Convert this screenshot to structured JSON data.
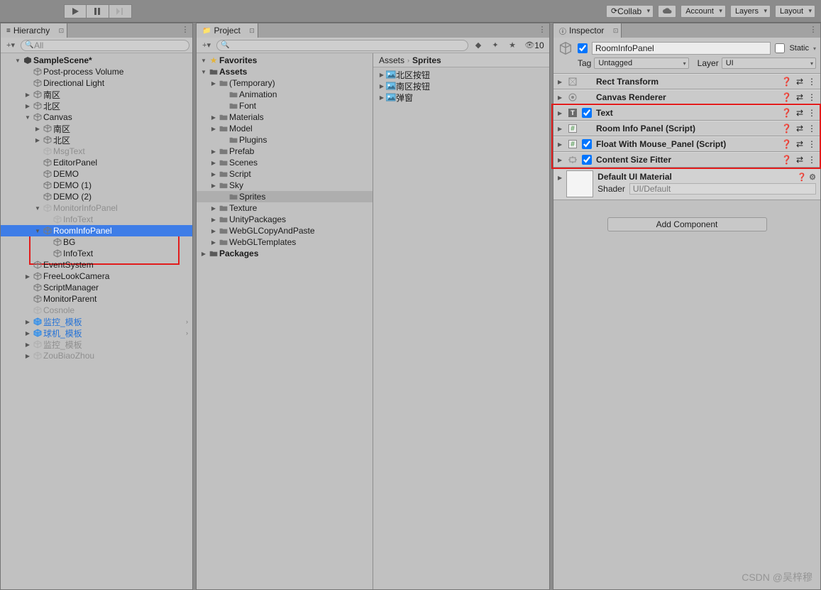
{
  "toolbar": {
    "collab": "Collab",
    "account": "Account",
    "layers": "Layers",
    "layout": "Layout"
  },
  "hierarchy": {
    "tab": "Hierarchy",
    "search_placeholder": "All",
    "items": [
      {
        "d": 0,
        "l": "SampleScene*",
        "f": "open",
        "bold": true,
        "type": "scene"
      },
      {
        "d": 1,
        "l": "Post-process Volume",
        "f": "none"
      },
      {
        "d": 1,
        "l": "Directional Light",
        "f": "none"
      },
      {
        "d": 1,
        "l": "南区",
        "f": "closed"
      },
      {
        "d": 1,
        "l": "北区",
        "f": "closed"
      },
      {
        "d": 1,
        "l": "Canvas",
        "f": "open"
      },
      {
        "d": 2,
        "l": "南区",
        "f": "closed"
      },
      {
        "d": 2,
        "l": "北区",
        "f": "closed"
      },
      {
        "d": 2,
        "l": "MsgText",
        "f": "none",
        "dim": true
      },
      {
        "d": 2,
        "l": "EditorPanel",
        "f": "none"
      },
      {
        "d": 2,
        "l": "DEMO",
        "f": "none"
      },
      {
        "d": 2,
        "l": "DEMO (1)",
        "f": "none"
      },
      {
        "d": 2,
        "l": "DEMO (2)",
        "f": "none"
      },
      {
        "d": 2,
        "l": "MonitorInfoPanel",
        "f": "open",
        "dim": true
      },
      {
        "d": 3,
        "l": "InfoText",
        "f": "none",
        "dim": true
      },
      {
        "d": 2,
        "l": "RoomInfoPanel",
        "f": "open",
        "sel": true
      },
      {
        "d": 3,
        "l": "BG",
        "f": "none"
      },
      {
        "d": 3,
        "l": "InfoText",
        "f": "none"
      },
      {
        "d": 1,
        "l": "EventSystem",
        "f": "none"
      },
      {
        "d": 1,
        "l": "FreeLookCamera",
        "f": "closed"
      },
      {
        "d": 1,
        "l": "ScriptManager",
        "f": "none"
      },
      {
        "d": 1,
        "l": "MonitorParent",
        "f": "none"
      },
      {
        "d": 1,
        "l": "Cosnole",
        "f": "none",
        "dim": true
      },
      {
        "d": 1,
        "l": "监控_模板",
        "f": "closed",
        "blue": true,
        "prefab": true,
        "ov": true
      },
      {
        "d": 1,
        "l": "球机_模板",
        "f": "closed",
        "blue": true,
        "prefab": true,
        "ov": true
      },
      {
        "d": 1,
        "l": "监控_模板",
        "f": "closed",
        "dim": true
      },
      {
        "d": 1,
        "l": "ZouBiaoZhou",
        "f": "closed",
        "dim": true
      }
    ]
  },
  "project": {
    "tab": "Project",
    "hidden_count": "10",
    "tree": [
      {
        "d": 0,
        "l": "Favorites",
        "f": "open",
        "fav": true
      },
      {
        "d": 0,
        "l": "Assets",
        "f": "open",
        "root": true
      },
      {
        "d": 1,
        "l": "(Temporary)",
        "f": "closed"
      },
      {
        "d": 2,
        "l": "Animation",
        "f": "none"
      },
      {
        "d": 2,
        "l": "Font",
        "f": "none"
      },
      {
        "d": 1,
        "l": "Materials",
        "f": "closed"
      },
      {
        "d": 1,
        "l": "Model",
        "f": "closed"
      },
      {
        "d": 2,
        "l": "Plugins",
        "f": "none"
      },
      {
        "d": 1,
        "l": "Prefab",
        "f": "closed"
      },
      {
        "d": 1,
        "l": "Scenes",
        "f": "closed"
      },
      {
        "d": 1,
        "l": "Script",
        "f": "closed"
      },
      {
        "d": 1,
        "l": "Sky",
        "f": "closed"
      },
      {
        "d": 2,
        "l": "Sprites",
        "f": "none",
        "sel": true
      },
      {
        "d": 1,
        "l": "Texture",
        "f": "closed"
      },
      {
        "d": 1,
        "l": "UnityPackages",
        "f": "closed"
      },
      {
        "d": 1,
        "l": "WebGLCopyAndPaste",
        "f": "closed"
      },
      {
        "d": 1,
        "l": "WebGLTemplates",
        "f": "closed"
      },
      {
        "d": 0,
        "l": "Packages",
        "f": "closed",
        "root": true
      }
    ],
    "breadcrumb": [
      "Assets",
      "Sprites"
    ],
    "assets": [
      "北区按钮",
      "南区按钮",
      "弹窗"
    ]
  },
  "inspector": {
    "tab": "Inspector",
    "name": "RoomInfoPanel",
    "static": "Static",
    "tag_label": "Tag",
    "tag": "Untagged",
    "layer_label": "Layer",
    "layer": "UI",
    "components": [
      {
        "title": "Rect Transform",
        "icon": "rect",
        "chk": null
      },
      {
        "title": "Canvas Renderer",
        "icon": "circle",
        "chk": null
      },
      {
        "title": "Text",
        "icon": "T",
        "chk": true
      },
      {
        "title": "Room Info Panel (Script)",
        "icon": "#",
        "chk": null
      },
      {
        "title": "Float With Mouse_Panel (Script)",
        "icon": "#",
        "chk": true
      },
      {
        "title": "Content Size Fitter",
        "icon": "fit",
        "chk": true
      }
    ],
    "material": {
      "title": "Default UI Material",
      "shader_label": "Shader",
      "shader": "UI/Default"
    },
    "add": "Add Component"
  },
  "watermark": "CSDN @吴梓穆"
}
